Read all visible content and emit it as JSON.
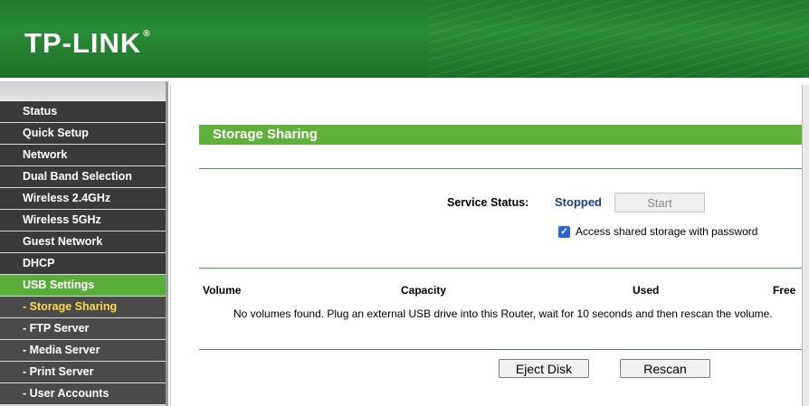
{
  "header": {
    "logo": "TP-LINK",
    "logo_mark": "®"
  },
  "sidebar": {
    "items": [
      {
        "label": "Status"
      },
      {
        "label": "Quick Setup"
      },
      {
        "label": "Network"
      },
      {
        "label": "Dual Band Selection"
      },
      {
        "label": "Wireless 2.4GHz"
      },
      {
        "label": "Wireless 5GHz"
      },
      {
        "label": "Guest Network"
      },
      {
        "label": "DHCP"
      },
      {
        "label": "USB Settings"
      },
      {
        "label": "- Storage Sharing"
      },
      {
        "label": "- FTP Server"
      },
      {
        "label": "- Media Server"
      },
      {
        "label": "- Print Server"
      },
      {
        "label": "- User Accounts"
      }
    ]
  },
  "main": {
    "title": "Storage Sharing",
    "service_status_label": "Service Status:",
    "service_status_value": "Stopped",
    "start_button": "Start",
    "password_checkbox_label": "Access shared storage with password",
    "password_checkbox_checked": true,
    "table": {
      "columns": [
        "Volume",
        "Capacity",
        "Used",
        "Free"
      ],
      "empty_message": "No volumes found. Plug an external USB drive into this Router, wait for 10 seconds and then rescan the volume."
    },
    "eject_button": "Eject Disk",
    "rescan_button": "Rescan"
  },
  "colors": {
    "brand_green": "#5fb13b",
    "menu_dark": "#3a3a3a",
    "status_stopped": "#1e3c8c",
    "current_submenu": "#ffd94a"
  }
}
